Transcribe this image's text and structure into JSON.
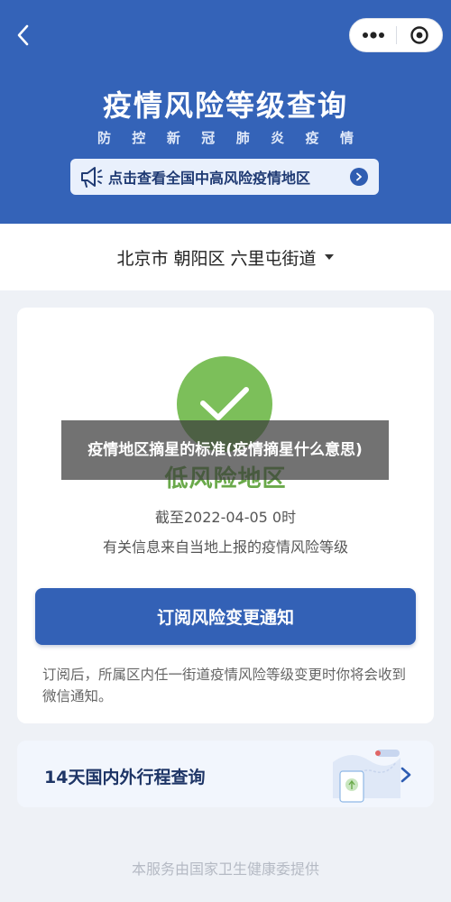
{
  "header": {
    "title": "疫情风险等级查询",
    "subtitle_chars": [
      "防",
      "控",
      "新",
      "冠",
      "肺",
      "炎",
      "疫",
      "情"
    ],
    "notice": "点击查看全国中高风险疫情地区",
    "bg_color": "#3463b8"
  },
  "location": {
    "text": "北京市 朝阳区 六里屯街道"
  },
  "status": {
    "risk_level": "低风险地区",
    "timestamp": "截至2022-04-05 0时",
    "source": "有关信息来自当地上报的疫情风险等级",
    "color": "#7cbf5a"
  },
  "subscribe": {
    "button_label": "订阅风险变更通知",
    "description": "订阅后，所属区内任一街道疫情风险等级变更时你将会收到微信通知。"
  },
  "trip": {
    "label": "14天国内外行程查询"
  },
  "footer": {
    "text": "本服务由国家卫生健康委提供"
  },
  "overlay": {
    "caption": "疫情地区摘星的标准(疫情摘星什么意思)"
  },
  "icons": {
    "back": "back-arrow-icon",
    "more": "more-dots-icon",
    "close": "close-target-icon",
    "speaker": "speaker-icon",
    "chevron": "chevron-right-icon",
    "check": "checkmark-icon"
  }
}
